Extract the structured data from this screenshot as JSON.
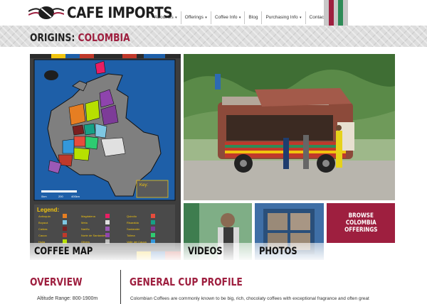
{
  "header": {
    "brand": "CAFE IMPORTS",
    "nav": [
      {
        "label": "About Us",
        "dropdown": true
      },
      {
        "label": "Offerings",
        "dropdown": true
      },
      {
        "label": "Coffee Info",
        "dropdown": true
      },
      {
        "label": "Blog",
        "dropdown": false
      },
      {
        "label": "Purchasing Info",
        "dropdown": true
      },
      {
        "label": "Contact Us",
        "dropdown": false
      }
    ],
    "flag_colors": [
      "#c8c8c8",
      "#9e1f3f",
      "#c8c8c8",
      "#2e8b57",
      "#c8c8c8"
    ]
  },
  "page": {
    "origin_label": "ORIGINS:",
    "origin_country": "COLOMBIA"
  },
  "tiles": {
    "map": {
      "caption": "COFFEE MAP",
      "legend_title": "Legend:",
      "key_title": "Key:",
      "scale_labels": [
        "0km",
        "200",
        "400km"
      ],
      "legend_items": [
        {
          "name": "Antioquia",
          "color": "#e67e22"
        },
        {
          "name": "Boyacá",
          "color": "#7ec8e3"
        },
        {
          "name": "Caldas",
          "color": "#7a1f1f"
        },
        {
          "name": "Cauca",
          "color": "#c0392b"
        },
        {
          "name": "Huila",
          "color": "#b7e000"
        },
        {
          "name": "Magdalena",
          "color": "#e91e63"
        },
        {
          "name": "Meta",
          "color": "#e0e0e0"
        },
        {
          "name": "Nariño",
          "color": "#9b59b6"
        },
        {
          "name": "Norte de Santander",
          "color": "#8e44ad"
        },
        {
          "name": "Others",
          "color": "#bdbdbd"
        },
        {
          "name": "Quindío",
          "color": "#e74c3c"
        },
        {
          "name": "Risaralda",
          "color": "#16a085"
        },
        {
          "name": "Santander",
          "color": "#7d3c98"
        },
        {
          "name": "Tolima",
          "color": "#2ecc71"
        },
        {
          "name": "Valle del Cauca",
          "color": "#3498db"
        }
      ]
    },
    "videos": {
      "caption": "VIDEOS"
    },
    "photos": {
      "caption": "PHOTOS"
    },
    "browse": {
      "label": "BROWSE\nCOLOMBIA\nOFFERINGS"
    }
  },
  "overview": {
    "title": "OVERVIEW",
    "altitude": "Altitude Range: 800-1900m"
  },
  "cup_profile": {
    "title": "GENERAL CUP PROFILE",
    "description": "Colombian Coffees are commonly known to be big, rich, chocolaty coffees with exceptional fragrance and often great"
  },
  "colors": {
    "accent": "#9e1f3f",
    "map_bg": "#3d3d3d",
    "ocean": "#1e5fa8"
  }
}
